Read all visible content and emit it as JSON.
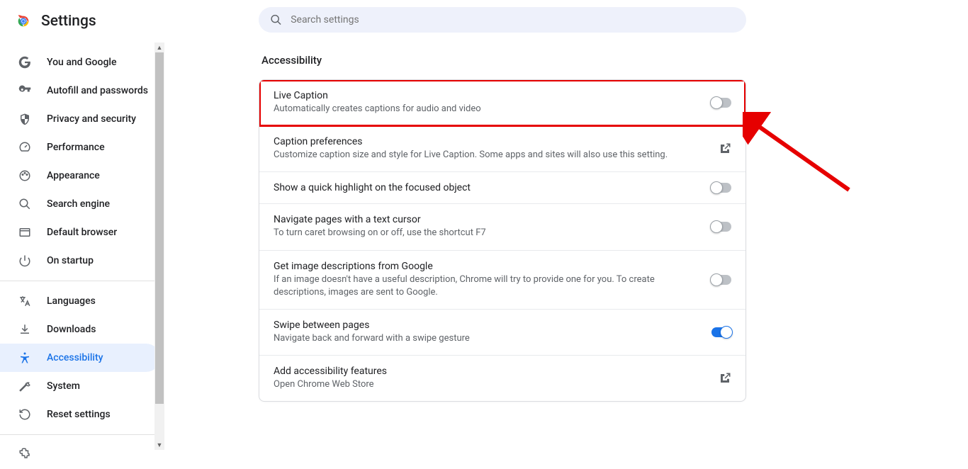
{
  "header": {
    "title": "Settings"
  },
  "search": {
    "placeholder": "Search settings"
  },
  "sidebar": {
    "items": [
      {
        "label": "You and Google"
      },
      {
        "label": "Autofill and passwords"
      },
      {
        "label": "Privacy and security"
      },
      {
        "label": "Performance"
      },
      {
        "label": "Appearance"
      },
      {
        "label": "Search engine"
      },
      {
        "label": "Default browser"
      },
      {
        "label": "On startup"
      },
      {
        "label": "Languages"
      },
      {
        "label": "Downloads"
      },
      {
        "label": "Accessibility"
      },
      {
        "label": "System"
      },
      {
        "label": "Reset settings"
      }
    ]
  },
  "main": {
    "section_title": "Accessibility",
    "rows": [
      {
        "title": "Live Caption",
        "sub": "Automatically creates captions for audio and video",
        "control": "toggle",
        "on": false,
        "highlight": true
      },
      {
        "title": "Caption preferences",
        "sub": "Customize caption size and style for Live Caption. Some apps and sites will also use this setting.",
        "control": "external"
      },
      {
        "title": "Show a quick highlight on the focused object",
        "sub": "",
        "control": "toggle",
        "on": false
      },
      {
        "title": "Navigate pages with a text cursor",
        "sub": "To turn caret browsing on or off, use the shortcut F7",
        "control": "toggle",
        "on": false
      },
      {
        "title": "Get image descriptions from Google",
        "sub": "If an image doesn't have a useful description, Chrome will try to provide one for you. To create descriptions, images are sent to Google.",
        "control": "toggle",
        "on": false
      },
      {
        "title": "Swipe between pages",
        "sub": "Navigate back and forward with a swipe gesture",
        "control": "toggle",
        "on": true
      },
      {
        "title": "Add accessibility features",
        "sub": "Open Chrome Web Store",
        "control": "external"
      }
    ]
  }
}
